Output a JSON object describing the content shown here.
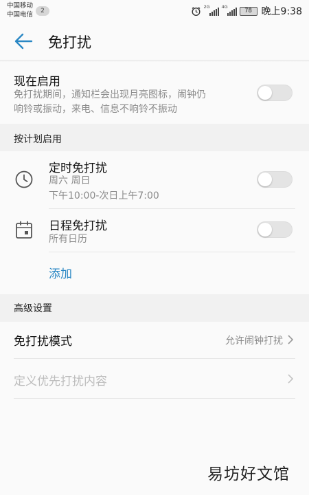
{
  "status_bar": {
    "carrier_1": "中国移动",
    "carrier_2": "中国电信",
    "sim_badge": "2",
    "network_1": "2G",
    "network_2": "4G",
    "battery": "78",
    "time": "晚上9:38",
    "icons": [
      "alarm-icon",
      "signal-icon",
      "signal-icon",
      "battery-icon"
    ]
  },
  "app_bar": {
    "title": "免打扰",
    "back_icon": "arrow-left-icon"
  },
  "now_enabled": {
    "title": "现在启用",
    "desc_line1": "免打扰期间，通知栏会出现月亮图标，闹钟仍",
    "desc_line2": "响铃或振动，来电、信息不响铃不振动",
    "toggle_on": false
  },
  "schedule_section": {
    "header": "按计划启用",
    "timed": {
      "title": "定时免打扰",
      "days": "周六 周日",
      "time_range": "下午10:00-次日上午7:00",
      "icon": "clock-icon",
      "toggle_on": false
    },
    "calendar": {
      "title": "日程免打扰",
      "subtitle": "所有日历",
      "icon": "calendar-icon",
      "toggle_on": false
    },
    "add_label": "添加"
  },
  "advanced_section": {
    "header": "高级设置",
    "mode": {
      "title": "免打扰模式",
      "value": "允许闹钟打扰"
    },
    "priority": {
      "title": "定义优先打扰内容",
      "enabled": false
    }
  },
  "watermark": "易坊好文馆",
  "colors": {
    "accent": "#2a87c4",
    "background": "#fafafa",
    "section_header_bg": "#f1f1f1",
    "secondary_text": "#8a8a8a"
  }
}
